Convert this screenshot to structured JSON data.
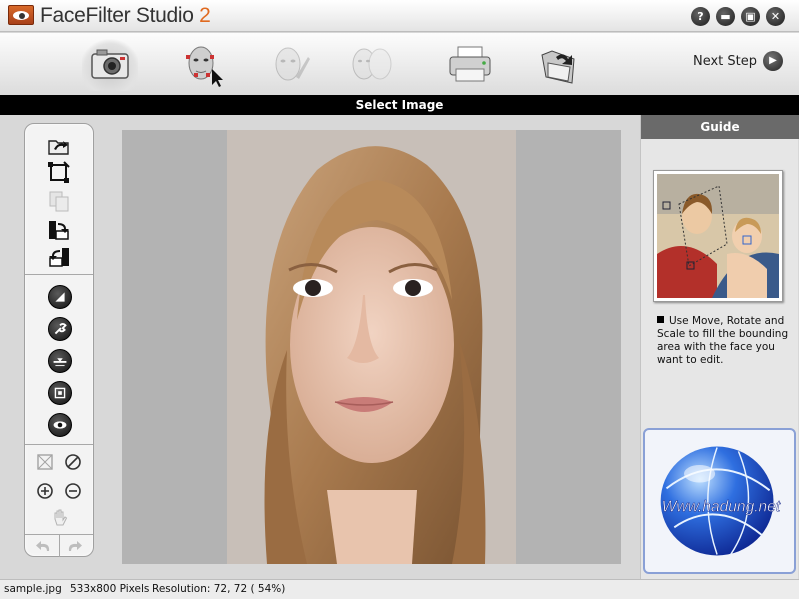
{
  "window": {
    "title_main": "FaceFilter Studio ",
    "title_version": "2",
    "buttons": [
      "?",
      "▬",
      "▣",
      "✕"
    ]
  },
  "toolbar": {
    "steps": [
      {
        "name": "select-image",
        "icon": "camera-icon",
        "active": true
      },
      {
        "name": "face-detect",
        "icon": "face-cursor-icon",
        "active": false
      },
      {
        "name": "edit-face",
        "icon": "face-brush-icon",
        "active": false
      },
      {
        "name": "compare",
        "icon": "faces-compare-icon",
        "active": false
      },
      {
        "name": "print",
        "icon": "printer-icon",
        "active": false
      },
      {
        "name": "save",
        "icon": "folder-arrow-icon",
        "active": false
      }
    ],
    "next_step_label": "Next Step"
  },
  "header": {
    "title": "Select Image"
  },
  "tools": {
    "file_tools": [
      "open-icon",
      "crop-icon",
      "paste-icon",
      "rotate-right-icon",
      "rotate-left-icon"
    ],
    "adjust_tools": [
      "contrast-icon",
      "wrench-icon",
      "level-icon",
      "frame-icon",
      "redeye-icon"
    ],
    "view_tools": [
      "fit-icon",
      "no-icon",
      "zoom-in-icon",
      "zoom-out-icon",
      "hand-icon"
    ],
    "history": [
      "undo-icon",
      "redo-icon"
    ]
  },
  "guide": {
    "title": "Guide",
    "text": "Use Move, Rotate and Scale to fill the bounding area with the face you want to edit."
  },
  "watermark": {
    "text": "Www.hadung.net"
  },
  "status": {
    "filename": "sample.jpg",
    "dimensions": "533x800 Pixels",
    "resolution": "Resolution: 72, 72 ( 54%)"
  }
}
